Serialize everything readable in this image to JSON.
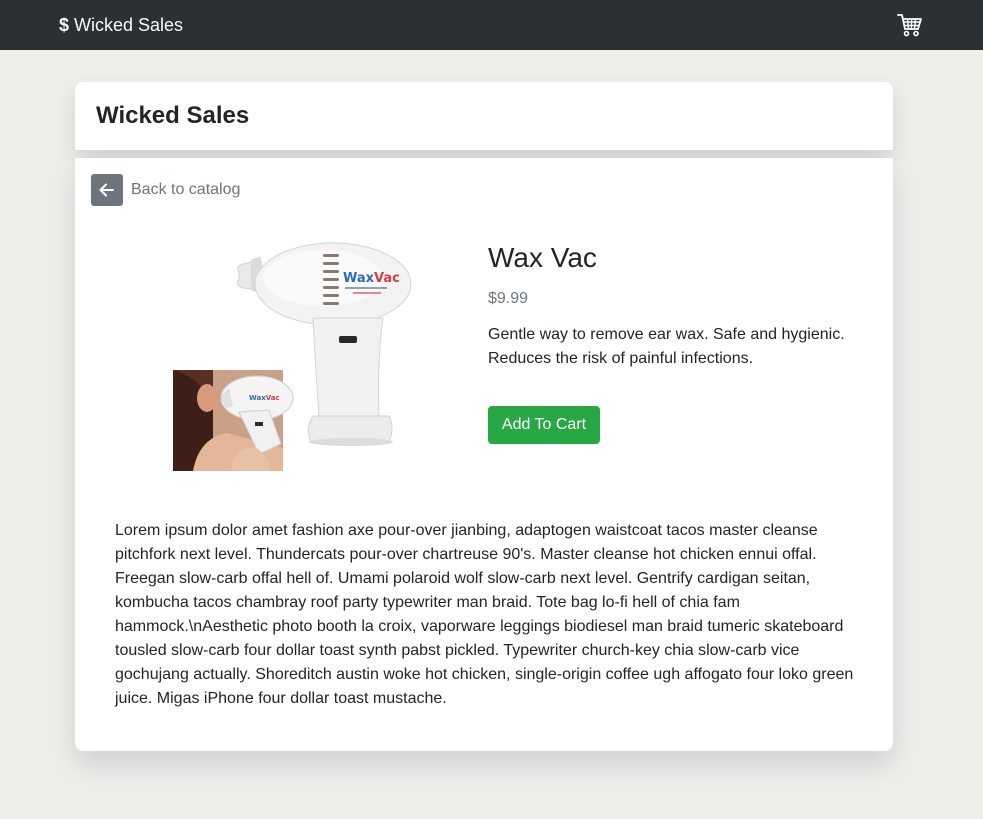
{
  "navbar": {
    "brand_symbol": "$",
    "brand_name": "Wicked Sales",
    "cart_icon": "shopping-cart-icon"
  },
  "header": {
    "title": "Wicked Sales"
  },
  "back": {
    "icon": "arrow-left-icon",
    "label": "Back to catalog"
  },
  "product": {
    "name": "Wax Vac",
    "price": "$9.99",
    "short_description": "Gentle way to remove ear wax. Safe and hygienic. Reduces the risk of painful infections.",
    "add_to_cart_label": "Add To Cart",
    "image_label": "WaxVac",
    "long_description": "Lorem ipsum dolor amet fashion axe pour-over jianbing, adaptogen waistcoat tacos master cleanse pitchfork next level. Thundercats pour-over chartreuse 90's. Master cleanse hot chicken ennui offal. Freegan slow-carb offal hell of. Umami polaroid wolf slow-carb next level. Gentrify cardigan seitan, kombucha tacos chambray roof party typewriter man braid. Tote bag lo-fi hell of chia fam hammock.\\nAesthetic photo booth la croix, vaporware leggings biodiesel man braid tumeric skateboard tousled slow-carb four dollar toast synth pabst pickled. Typewriter church-key chia slow-carb vice gochujang actually. Shoreditch austin woke hot chicken, single-origin coffee ugh affogato four loko green juice. Migas iPhone four dollar toast mustache."
  },
  "colors": {
    "navbar_bg": "#2b3035",
    "page_bg": "#efeeeb",
    "button_green": "#28a745",
    "muted_gray": "#6c757d"
  }
}
